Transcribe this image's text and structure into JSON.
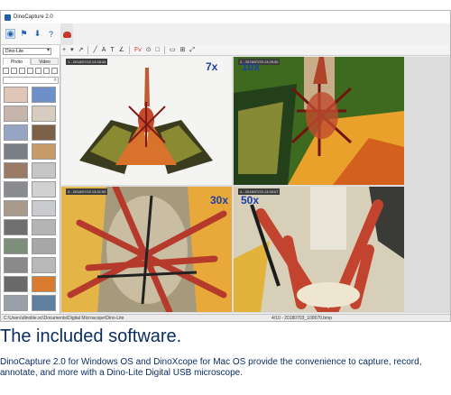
{
  "window": {
    "title": "DinoCapture 2.0"
  },
  "sidebar": {
    "device": "Dino-Lite",
    "tabs": [
      "Photo",
      "Video"
    ],
    "ribbon_icons": [
      "camera-icon",
      "flag-icon",
      "download-icon",
      "help-icon"
    ],
    "thumbnails": [
      "#e0c7b8",
      "#6e8fc9",
      "#c6b5aa",
      "#d6cdc0",
      "#97a5c4",
      "#7c6148",
      "#7b7f86",
      "#c79a6a",
      "#9a7c66",
      "#c6c6c6",
      "#8b8c8f",
      "#d1d1d1",
      "#a89b8e",
      "#c9cbd0",
      "#707070",
      "#b4b4b4",
      "#7d8f7a",
      "#a7a7a7",
      "#8a8a8a",
      "#b9b9b9",
      "#6a6a6a",
      "#d87b2e",
      "#9aa0a8",
      "#5f7fa0"
    ]
  },
  "toolbar": {
    "items": [
      "+",
      "▾",
      "↗",
      "╱",
      "A",
      "T",
      "∠",
      "Fv",
      "⊙",
      "□",
      "▭",
      "⊞",
      "⤢"
    ]
  },
  "views": [
    {
      "magnification": "7x",
      "tag": "1 - 2018/07/23 13:28:44"
    },
    {
      "magnification": "10x",
      "tag": "2 - 2018/07/23 13:29:30"
    },
    {
      "magnification": "30x",
      "tag": "3 - 2018/07/23 13:31:50"
    },
    {
      "magnification": "50x",
      "tag": "4 - 2018/07/23 13:33:07"
    }
  ],
  "status": {
    "path": "C:\\Users\\dinolite.sc\\Documents\\Digital Microscope\\Dino-Lite",
    "file": "4/10 - 20180703_100070.bmp"
  },
  "caption": {
    "title": "The included software.",
    "body": "DinoCapture 2.0 for Windows OS and DinoXcope for Mac OS provide the convenience to capture, record, annotate, and more with a Dino-Lite Digital USB microscope."
  },
  "colors": {
    "accent": "#1f3ea5",
    "caption": "#0b2e63",
    "app_blue": "#1f5fa8"
  }
}
